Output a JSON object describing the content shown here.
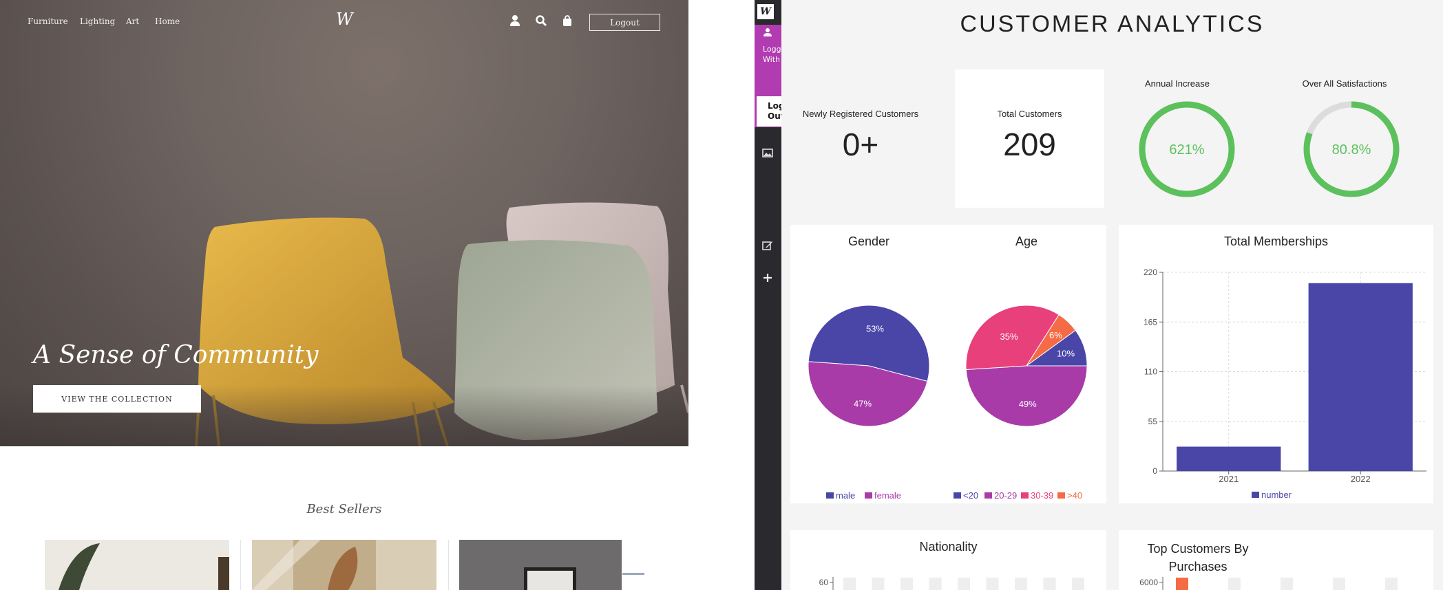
{
  "store": {
    "nav": [
      "Furniture",
      "Lighting",
      "Art",
      "Home"
    ],
    "logo": "W",
    "logout_label": "Logout",
    "hero_title": "A Sense of Community",
    "hero_button": "VIEW THE COLLECTION",
    "best_sellers_title": "Best Sellers"
  },
  "sidebar": {
    "logo": "W",
    "user_text": "Logged In With demo",
    "logout_label": "Log Out",
    "icons": [
      "wix-logo-icon",
      "user-icon",
      "help-icon",
      "image-icon",
      "edit-icon",
      "plus-icon"
    ]
  },
  "dashboard": {
    "title": "CUSTOMER ANALYTICS",
    "kpis": {
      "new_label": "Newly Registered Customers",
      "new_value": "0+",
      "total_label": "Total Customers",
      "total_value": "209",
      "annual_label": "Annual Increase",
      "annual_value": "621%",
      "satisfaction_label": "Over All Satisfactions",
      "satisfaction_value": "80.8%"
    },
    "colors": {
      "accent_green": "#5cc15c",
      "indigo": "#4a46a8",
      "purple": "#a83ba8",
      "pink": "#e8407a",
      "orange": "#f56b45"
    }
  },
  "chart_data": [
    {
      "type": "pie",
      "title": "Gender",
      "categories": [
        "male",
        "female"
      ],
      "values": [
        53,
        47
      ],
      "labels": [
        "53%",
        "47%"
      ],
      "colors": [
        "#4a46a8",
        "#a83ba8"
      ],
      "legend": "bottom"
    },
    {
      "type": "pie",
      "title": "Age",
      "categories": [
        "<20",
        "20-29",
        "30-39",
        ">40"
      ],
      "values": [
        10,
        49,
        35,
        6
      ],
      "labels": [
        "10%",
        "49%",
        "35%",
        "6%"
      ],
      "colors": [
        "#4a46a8",
        "#a83ba8",
        "#e8407a",
        "#f56b45"
      ],
      "legend": "bottom"
    },
    {
      "type": "bar",
      "title": "Total Memberships",
      "categories": [
        "2021",
        "2022"
      ],
      "series": [
        {
          "name": "number",
          "values": [
            27,
            208
          ]
        }
      ],
      "yticks": [
        "0",
        "55",
        "110",
        "165",
        "220"
      ],
      "ylim": [
        0,
        220
      ],
      "grid": true,
      "legend": "bottom"
    },
    {
      "type": "bar",
      "title": "Nationality",
      "yticks": [
        "60"
      ]
    },
    {
      "type": "bar",
      "title": "Top Customers By Purchases",
      "yticks": [
        "6000"
      ]
    }
  ]
}
